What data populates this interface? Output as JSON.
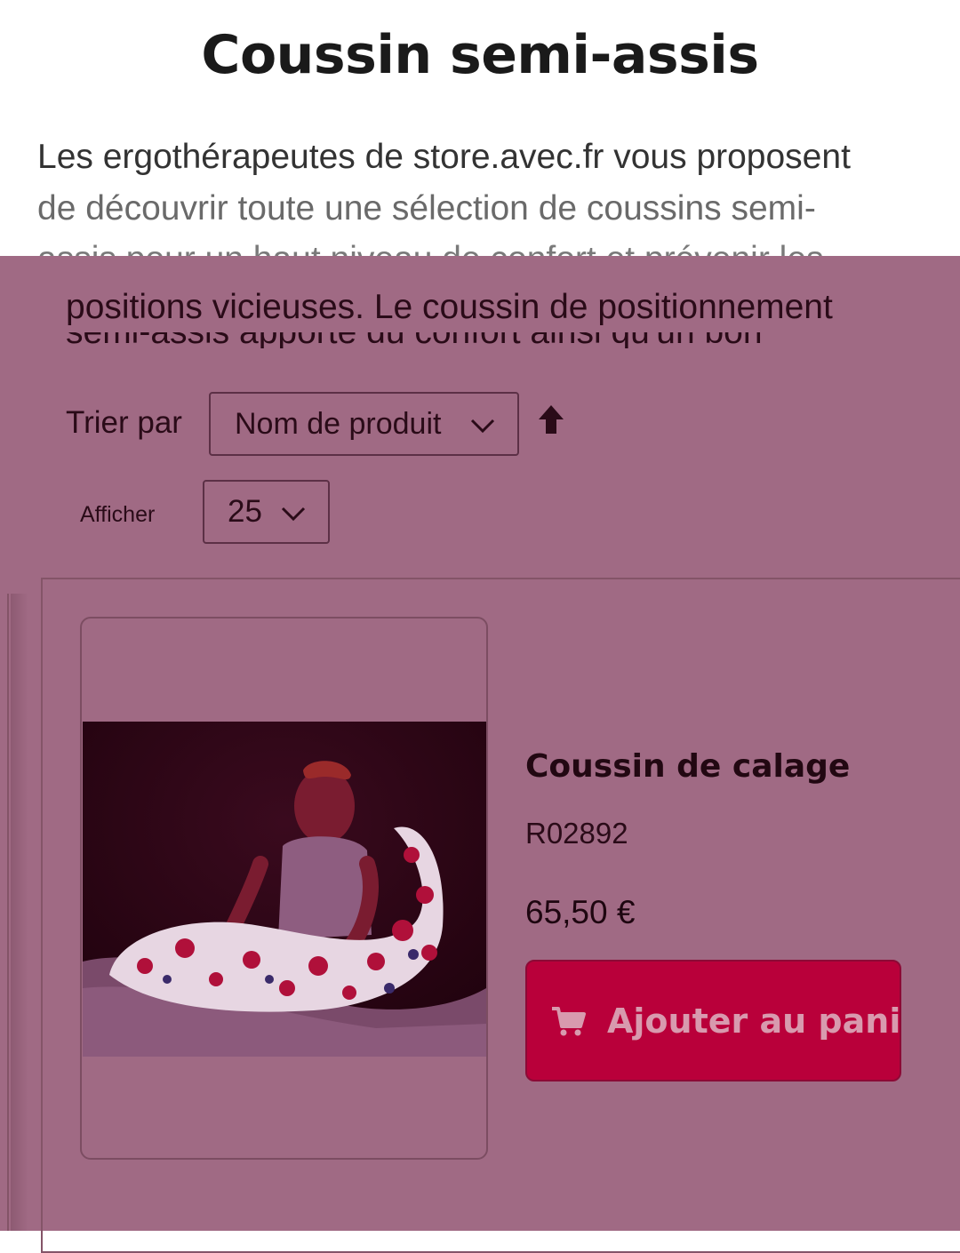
{
  "page": {
    "title": "Coussin semi-assis",
    "intro_lines": [
      "Les ergothérapeutes de store.avec.fr vous proposent",
      "de découvrir toute une sélection de coussins semi-",
      "assis pour un haut niveau de confort et prévenir les"
    ],
    "intro_continued": "positions vicieuses. Le coussin de positionnement",
    "intro_cut_line": "semi-assis apporte du confort ainsi qu'un bon"
  },
  "toolbar": {
    "sort_label": "Trier par",
    "sort_value": "Nom de produit",
    "sort_direction_icon": "arrow-up-icon",
    "show_label": "Afficher",
    "show_value": "25"
  },
  "products": [
    {
      "name": "Coussin de calage",
      "ref": "R02892",
      "price": "65,50 €",
      "add_to_cart_label": "Ajouter au panier",
      "cart_icon": "cart-icon"
    }
  ],
  "colors": {
    "overlay": "#a06a84",
    "button": "#b9003a",
    "title": "#1a1a1a"
  }
}
